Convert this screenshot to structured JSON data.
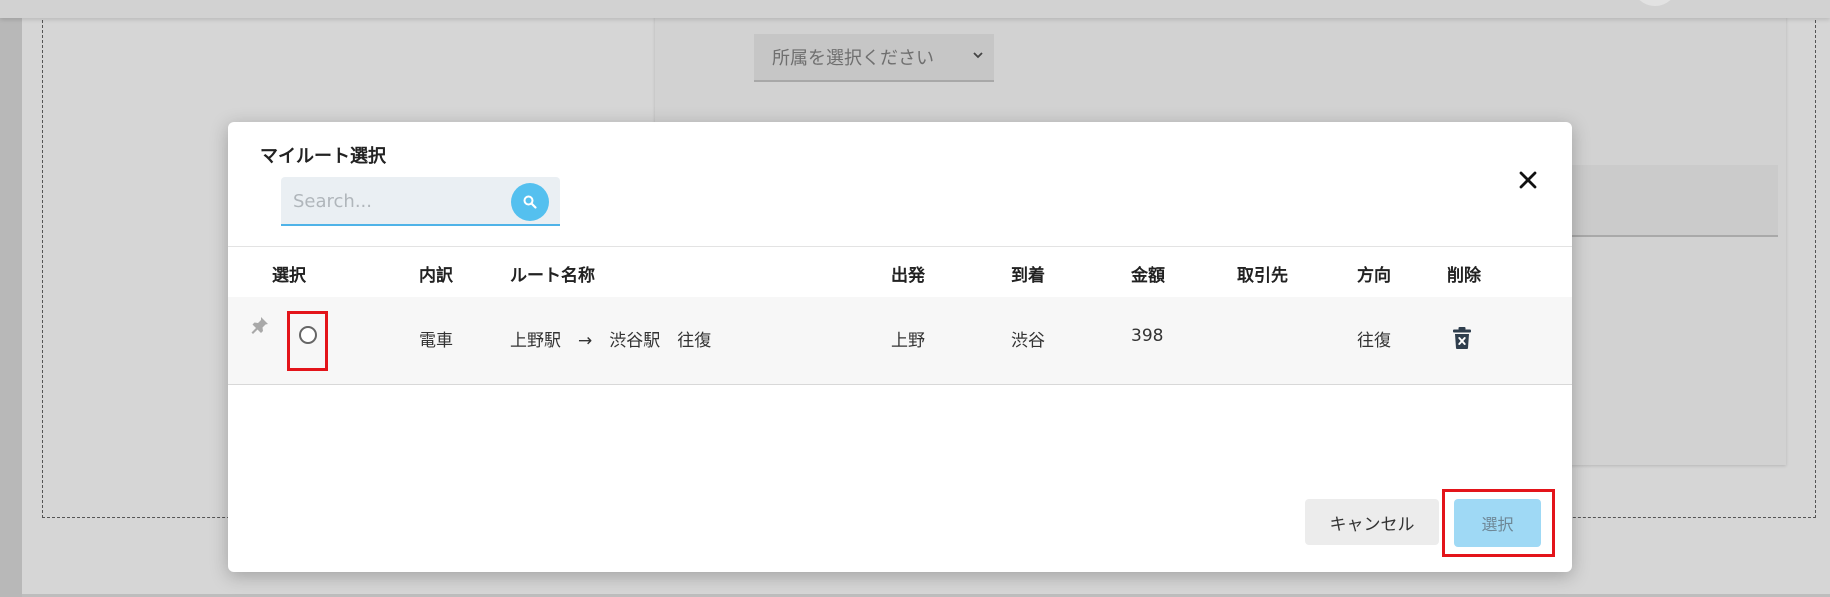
{
  "background": {
    "affiliation_select": {
      "placeholder": "所属を選択ください"
    }
  },
  "modal": {
    "title": "マイルート選択",
    "search": {
      "placeholder": "Search..."
    },
    "columns": {
      "select": "選択",
      "breakdown": "内訳",
      "route_name": "ルート名称",
      "departure": "出発",
      "arrival": "到着",
      "amount": "金額",
      "client": "取引先",
      "direction": "方向",
      "delete": "削除"
    },
    "rows": [
      {
        "breakdown": "電車",
        "route_name": "上野駅　→　渋谷駅　往復",
        "departure": "上野",
        "arrival": "渋谷",
        "amount": "398",
        "client": "",
        "direction": "往復"
      }
    ],
    "buttons": {
      "cancel": "キャンセル",
      "select": "選択"
    }
  },
  "colors": {
    "accent": "#54c0ef",
    "highlight_frame": "#e3141a",
    "select_button": "#9fd9f5"
  },
  "icons": {
    "search": "search-icon",
    "close": "close-icon",
    "pin": "pin-icon",
    "delete": "trash-delete-icon",
    "dropdown": "chevron-down-icon"
  }
}
